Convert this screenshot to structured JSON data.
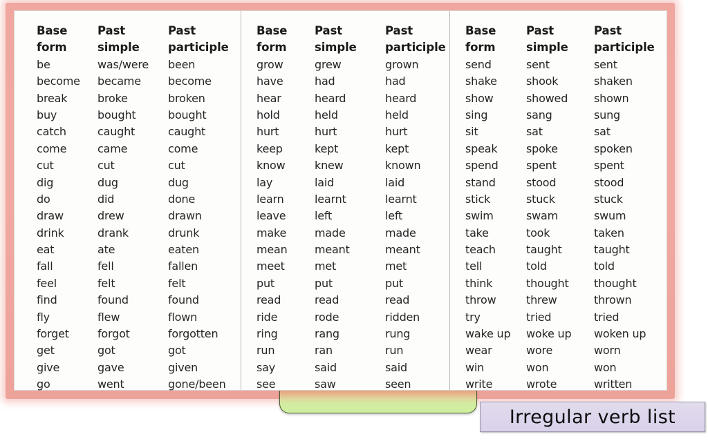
{
  "page": {
    "title_plate_label": "Irregular verb list",
    "frame_color": "#f0a69e",
    "panel_color": "#fdfdfb",
    "tab_color": "#cdf0a0",
    "title_plate_color": "#ded7ec"
  },
  "columns": {
    "base": "Base",
    "base2": "form",
    "past": "Past",
    "past2": "simple",
    "participle": "Past",
    "participle2": "participle"
  },
  "blocks": [
    {
      "headers": [
        "Base",
        "form",
        "Past",
        "simple",
        "Past",
        "participle"
      ],
      "rows": [
        [
          "be",
          "was/were",
          "been"
        ],
        [
          "become",
          "became",
          "become"
        ],
        [
          "break",
          "broke",
          "broken"
        ],
        [
          "buy",
          "bought",
          "bought"
        ],
        [
          "catch",
          "caught",
          "caught"
        ],
        [
          "come",
          "came",
          "come"
        ],
        [
          "cut",
          "cut",
          "cut"
        ],
        [
          "dig",
          "dug",
          "dug"
        ],
        [
          "do",
          "did",
          "done"
        ],
        [
          "draw",
          "drew",
          "drawn"
        ],
        [
          "drink",
          "drank",
          "drunk"
        ],
        [
          "eat",
          "ate",
          "eaten"
        ],
        [
          "fall",
          "fell",
          "fallen"
        ],
        [
          "feel",
          "felt",
          "felt"
        ],
        [
          "find",
          "found",
          "found"
        ],
        [
          "fly",
          "flew",
          "flown"
        ],
        [
          "forget",
          "forgot",
          "forgotten"
        ],
        [
          "get",
          "got",
          "got"
        ],
        [
          "give",
          "gave",
          "given"
        ],
        [
          "go",
          "went",
          "gone/been"
        ]
      ]
    },
    {
      "headers": [
        "Base",
        "form",
        "Past",
        "simple",
        "Past",
        "participle"
      ],
      "rows": [
        [
          "grow",
          "grew",
          "grown"
        ],
        [
          "have",
          "had",
          "had"
        ],
        [
          "hear",
          "heard",
          "heard"
        ],
        [
          "hold",
          "held",
          "held"
        ],
        [
          "hurt",
          "hurt",
          "hurt"
        ],
        [
          "keep",
          "kept",
          "kept"
        ],
        [
          "know",
          "knew",
          "known"
        ],
        [
          "lay",
          "laid",
          "laid"
        ],
        [
          "learn",
          "learnt",
          "learnt"
        ],
        [
          "leave",
          "left",
          "left"
        ],
        [
          "make",
          "made",
          "made"
        ],
        [
          "mean",
          "meant",
          "meant"
        ],
        [
          "meet",
          "met",
          "met"
        ],
        [
          "put",
          "put",
          "put"
        ],
        [
          "read",
          "read",
          "read"
        ],
        [
          "ride",
          "rode",
          "ridden"
        ],
        [
          "ring",
          "rang",
          "rung"
        ],
        [
          "run",
          "ran",
          "run"
        ],
        [
          "say",
          "said",
          "said"
        ],
        [
          "see",
          "saw",
          "seen"
        ]
      ]
    },
    {
      "headers": [
        "Base",
        "form",
        "Past",
        "simple",
        "Past",
        "participle"
      ],
      "rows": [
        [
          "send",
          "sent",
          "sent"
        ],
        [
          "shake",
          "shook",
          "shaken"
        ],
        [
          "show",
          "showed",
          "shown"
        ],
        [
          "sing",
          "sang",
          "sung"
        ],
        [
          "sit",
          "sat",
          "sat"
        ],
        [
          "speak",
          "spoke",
          "spoken"
        ],
        [
          "spend",
          "spent",
          "spent"
        ],
        [
          "stand",
          "stood",
          "stood"
        ],
        [
          "stick",
          "stuck",
          "stuck"
        ],
        [
          "swim",
          "swam",
          "swum"
        ],
        [
          "take",
          "took",
          "taken"
        ],
        [
          "teach",
          "taught",
          "taught"
        ],
        [
          "tell",
          "told",
          "told"
        ],
        [
          "think",
          "thought",
          "thought"
        ],
        [
          "throw",
          "threw",
          "thrown"
        ],
        [
          "try",
          "tried",
          "tried"
        ],
        [
          "wake up",
          "woke up",
          "woken up"
        ],
        [
          "wear",
          "wore",
          "worn"
        ],
        [
          "win",
          "won",
          "won"
        ],
        [
          "write",
          "wrote",
          "written"
        ]
      ]
    }
  ]
}
